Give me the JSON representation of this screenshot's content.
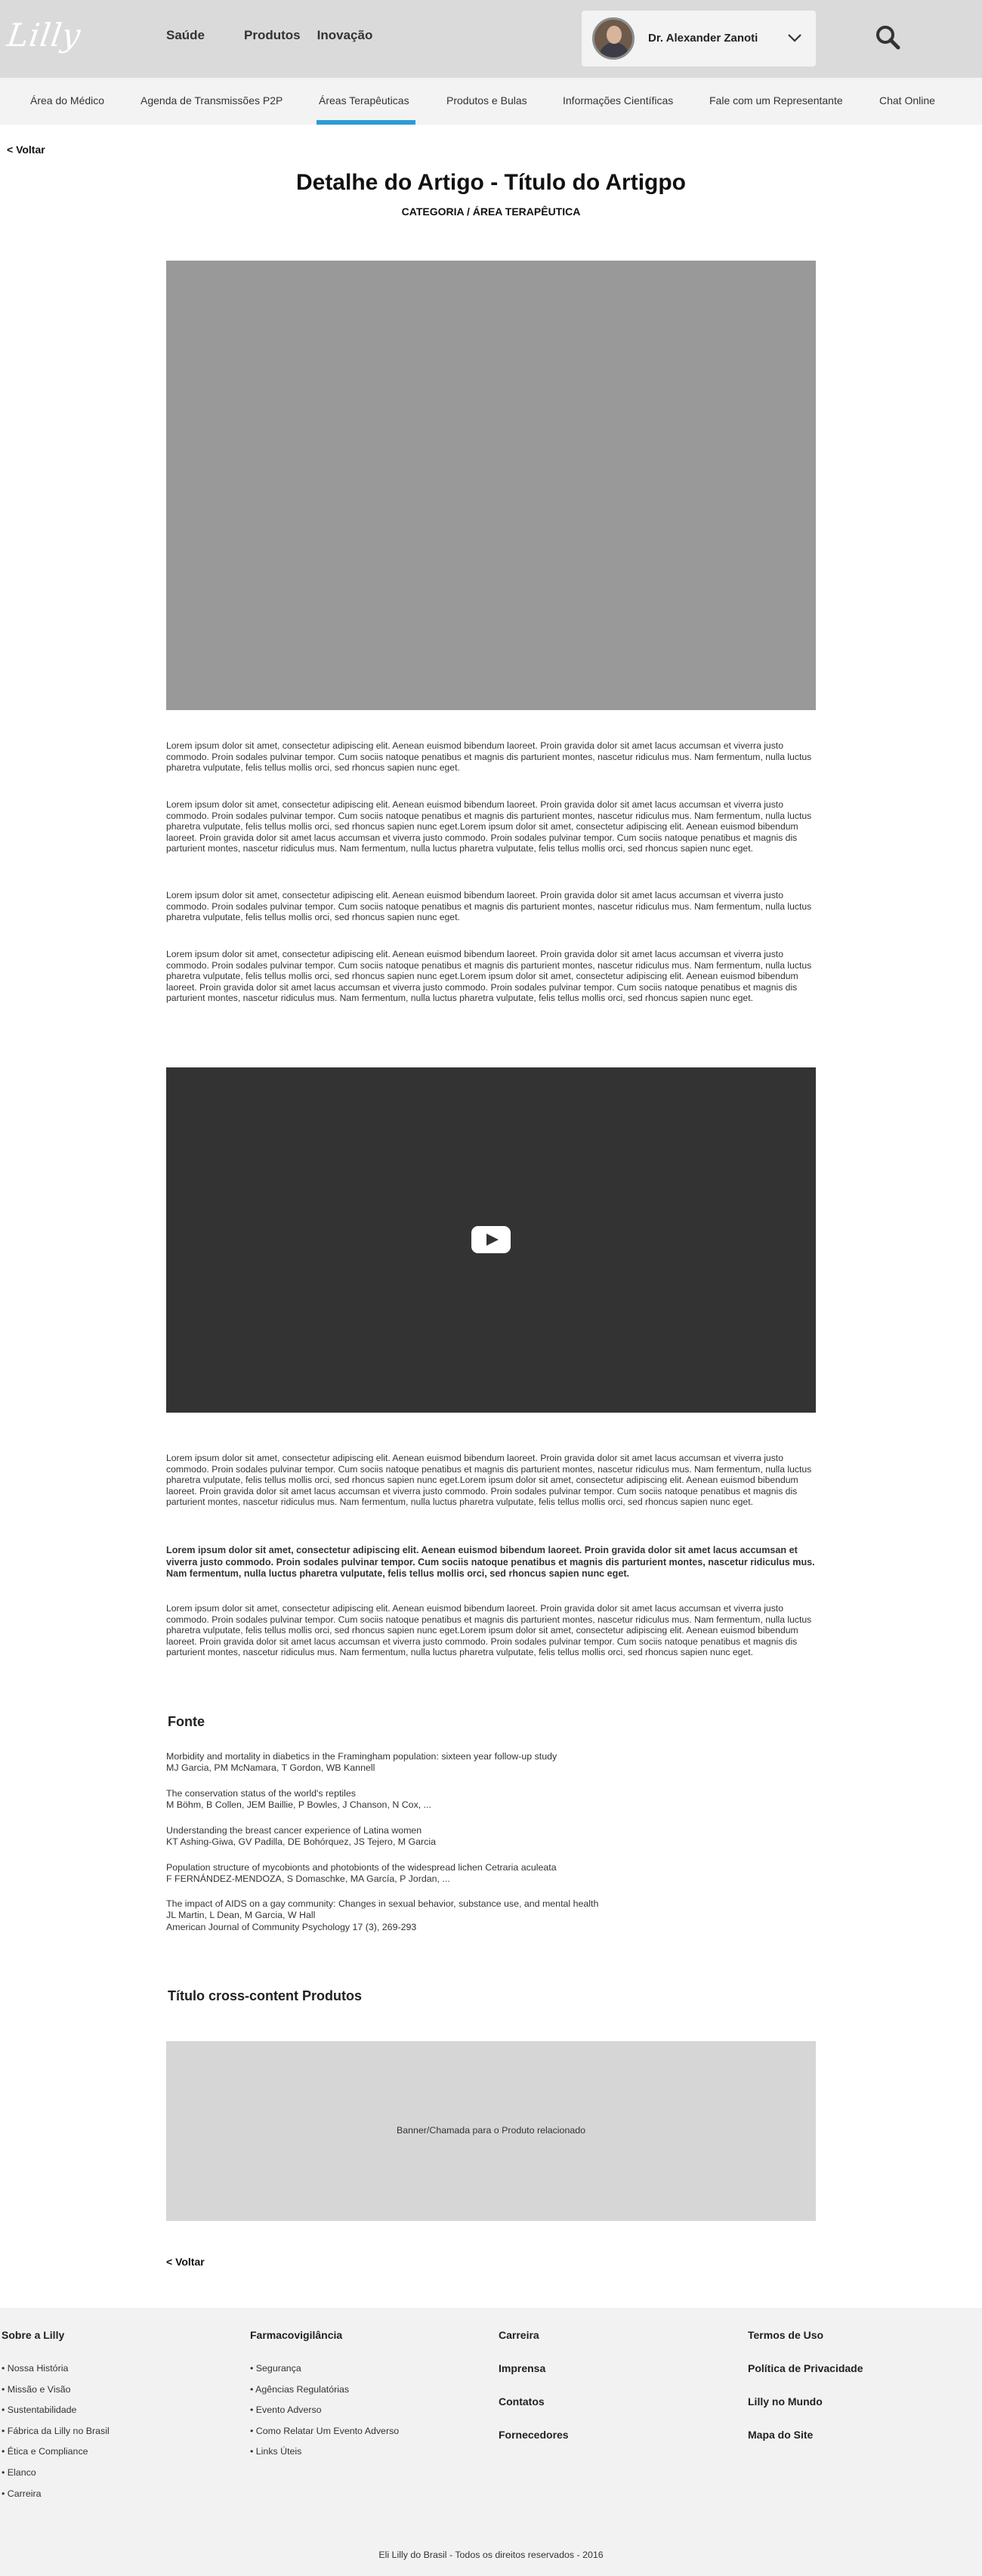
{
  "header": {
    "logo": "Lilly",
    "nav": [
      "Saúde",
      "Produtos",
      "Inovação"
    ],
    "user_name": "Dr. Alexander Zanoti"
  },
  "subnav": [
    "Área do Médico",
    "Agenda de Transmissões P2P",
    "Áreas Terapêuticas",
    "Produtos e Bulas",
    "Informações Científicas",
    "Fale com um Representante",
    "Chat Online"
  ],
  "back_label": "< Voltar",
  "article": {
    "title": "Detalhe do Artigo - Título do Artigpo",
    "category": "CATEGORIA / ÁREA TERAPÊUTICA",
    "paragraphs": [
      "Lorem ipsum dolor sit amet, consectetur adipiscing elit. Aenean euismod bibendum laoreet. Proin gravida dolor sit amet lacus accumsan et viverra justo commodo. Proin sodales pulvinar tempor. Cum sociis natoque penatibus et magnis dis parturient montes, nascetur ridiculus mus. Nam fermentum, nulla luctus pharetra vulputate, felis tellus mollis orci, sed rhoncus sapien nunc eget.",
      "Lorem ipsum dolor sit amet, consectetur adipiscing elit. Aenean euismod bibendum laoreet. Proin gravida dolor sit amet lacus accumsan et viverra justo commodo. Proin sodales pulvinar tempor. Cum sociis natoque penatibus et magnis dis parturient montes, nascetur ridiculus mus. Nam fermentum, nulla luctus pharetra vulputate, felis tellus mollis orci, sed rhoncus sapien nunc eget.Lorem ipsum dolor sit amet, consectetur adipiscing elit. Aenean euismod bibendum laoreet. Proin gravida dolor sit amet lacus accumsan et viverra justo commodo. Proin sodales pulvinar tempor. Cum sociis natoque penatibus et magnis dis parturient montes, nascetur ridiculus mus. Nam fermentum, nulla luctus pharetra vulputate, felis tellus mollis orci, sed rhoncus sapien nunc eget.",
      "Lorem ipsum dolor sit amet, consectetur adipiscing elit. Aenean euismod bibendum laoreet. Proin gravida dolor sit amet lacus accumsan et viverra justo commodo. Proin sodales pulvinar tempor. Cum sociis natoque penatibus et magnis dis parturient montes, nascetur ridiculus mus. Nam fermentum, nulla luctus pharetra vulputate, felis tellus mollis orci, sed rhoncus sapien nunc eget.",
      "Lorem ipsum dolor sit amet, consectetur adipiscing elit. Aenean euismod bibendum laoreet. Proin gravida dolor sit amet lacus accumsan et viverra justo commodo. Proin sodales pulvinar tempor. Cum sociis natoque penatibus et magnis dis parturient montes, nascetur ridiculus mus. Nam fermentum, nulla luctus pharetra vulputate, felis tellus mollis orci, sed rhoncus sapien nunc eget.Lorem ipsum dolor sit amet, consectetur adipiscing elit. Aenean euismod bibendum laoreet. Proin gravida dolor sit amet lacus accumsan et viverra justo commodo. Proin sodales pulvinar tempor. Cum sociis natoque penatibus et magnis dis parturient montes, nascetur ridiculus mus. Nam fermentum, nulla luctus pharetra vulputate, felis tellus mollis orci, sed rhoncus sapien nunc eget.",
      "Lorem ipsum dolor sit amet, consectetur adipiscing elit. Aenean euismod bibendum laoreet. Proin gravida dolor sit amet lacus accumsan et viverra justo commodo. Proin sodales pulvinar tempor. Cum sociis natoque penatibus et magnis dis parturient montes, nascetur ridiculus mus. Nam fermentum, nulla luctus pharetra vulputate, felis tellus mollis orci, sed rhoncus sapien nunc eget.Lorem ipsum dolor sit amet, consectetur adipiscing elit. Aenean euismod bibendum laoreet. Proin gravida dolor sit amet lacus accumsan et viverra justo commodo. Proin sodales pulvinar tempor. Cum sociis natoque penatibus et magnis dis parturient montes, nascetur ridiculus mus. Nam fermentum, nulla luctus pharetra vulputate, felis tellus mollis orci, sed rhoncus sapien nunc eget.",
      "Lorem ipsum dolor sit amet, consectetur adipiscing elit. Aenean euismod bibendum laoreet. Proin gravida dolor sit amet lacus accumsan et viverra justo commodo. Proin sodales pulvinar tempor. Cum sociis natoque penatibus et magnis dis parturient montes, nascetur ridiculus mus. Nam fermentum, nulla luctus pharetra vulputate, felis tellus mollis orci, sed rhoncus sapien nunc eget.",
      "Lorem ipsum dolor sit amet, consectetur adipiscing elit. Aenean euismod bibendum laoreet. Proin gravida dolor sit amet lacus accumsan et viverra justo commodo. Proin sodales pulvinar tempor. Cum sociis natoque penatibus et magnis dis parturient montes, nascetur ridiculus mus. Nam fermentum, nulla luctus pharetra vulputate, felis tellus mollis orci, sed rhoncus sapien nunc eget.Lorem ipsum dolor sit amet, consectetur adipiscing elit. Aenean euismod bibendum laoreet. Proin gravida dolor sit amet lacus accumsan et viverra justo commodo. Proin sodales pulvinar tempor. Cum sociis natoque penatibus et magnis dis parturient montes, nascetur ridiculus mus. Nam fermentum, nulla luctus pharetra vulputate, felis tellus mollis orci, sed rhoncus sapien nunc eget."
    ]
  },
  "sources": {
    "title": "Fonte",
    "refs": [
      [
        "Morbidity and mortality in diabetics in the Framingham population: sixteen year follow-up study",
        "MJ Garcia, PM McNamara, T Gordon, WB Kannell"
      ],
      [
        "The conservation status of the world's reptiles",
        "M Böhm, B Collen, JEM Baillie, P Bowles, J Chanson, N Cox, ..."
      ],
      [
        "Understanding the breast cancer experience of Latina women",
        "KT Ashing-Giwa, GV Padilla, DE Bohórquez, JS Tejero, M Garcia"
      ],
      [
        "Population structure of mycobionts and photobionts of the widespread lichen Cetraria aculeata",
        "F FERNÁNDEZ-MENDOZA, S Domaschke, MA García, P Jordan, ..."
      ],
      [
        "The impact of AIDS on a gay community: Changes in sexual behavior, substance use, and mental health",
        "JL Martin, L Dean, M Garcia, W Hall",
        "American Journal of Community Psychology 17 (3), 269-293"
      ]
    ]
  },
  "cross_content": {
    "title": "Título cross-content Produtos",
    "banner_text": "Banner/Chamada para o Produto relacionado"
  },
  "footer": {
    "col1_title": "Sobre a Lilly",
    "col1_items": [
      "• Nossa História",
      "• Missão e Visão",
      "• Sustentabilidade",
      "• Fábrica da Lilly no Brasil",
      "• Ética e Compliance",
      "• Elanco",
      "• Carreira"
    ],
    "col2_title": "Farmacovigilância",
    "col2_items": [
      "• Segurança",
      "• Agências Regulatórias",
      "• Evento Adverso",
      "• Como Relatar Um Evento Adverso",
      "• Links Úteis"
    ],
    "col3_links": [
      "Carreira",
      "Imprensa",
      "Contatos",
      "Fornecedores"
    ],
    "col4_links": [
      "Termos de Uso",
      "Política de Privacidade",
      "Lilly no Mundo",
      "Mapa do Site"
    ],
    "copyright": "Eli Lilly do Brasil - Todos os direitos reservados - 2016"
  },
  "colors": {
    "accent": "#2b9bd6",
    "header_bg": "#dadada",
    "image_placeholder": "#999999",
    "video_bg": "#333333"
  }
}
